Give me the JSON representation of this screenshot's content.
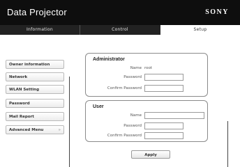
{
  "header": {
    "app_title": "Data Projector",
    "brand": "SONY"
  },
  "tabs": [
    {
      "label": "Information",
      "active": false
    },
    {
      "label": "Control",
      "active": false
    },
    {
      "label": "Setup",
      "active": true
    }
  ],
  "sidebar": {
    "items": [
      {
        "label": "Owner information"
      },
      {
        "label": "Network"
      },
      {
        "label": "WLAN Setting"
      },
      {
        "label": "Password"
      },
      {
        "label": "Mail Report"
      },
      {
        "label": "Advanced Menu",
        "chevron": "»"
      }
    ]
  },
  "administrator": {
    "title": "Administrator",
    "name_label": "Name",
    "name_value": "root",
    "password_label": "Password",
    "password_value": "",
    "confirm_label": "Confirm Password",
    "confirm_value": ""
  },
  "user": {
    "title": "User",
    "name_label": "Name",
    "name_value": "",
    "password_label": "Password",
    "password_value": "",
    "confirm_label": "Confirm Password",
    "confirm_value": ""
  },
  "apply_label": "Apply",
  "colors": {
    "header_bg": "#0e0e0e",
    "tabbar_bg": "#222222",
    "active_tab_bg": "#ffffff"
  }
}
